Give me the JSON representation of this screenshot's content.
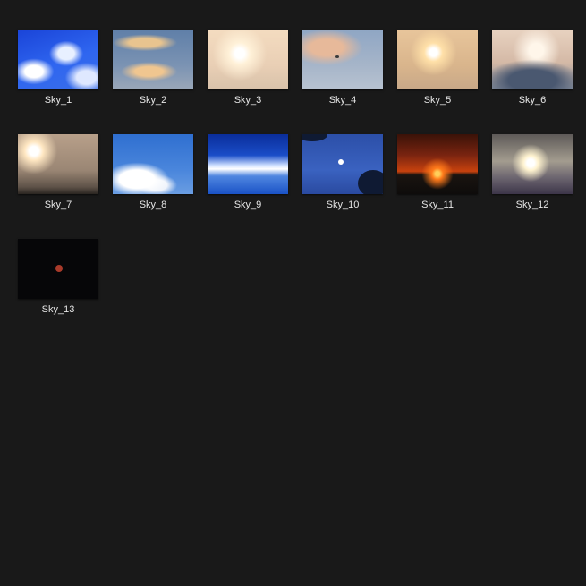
{
  "gallery": {
    "items": [
      {
        "label": "Sky_1"
      },
      {
        "label": "Sky_2"
      },
      {
        "label": "Sky_3"
      },
      {
        "label": "Sky_4"
      },
      {
        "label": "Sky_5"
      },
      {
        "label": "Sky_6"
      },
      {
        "label": "Sky_7"
      },
      {
        "label": "Sky_8"
      },
      {
        "label": "Sky_9"
      },
      {
        "label": "Sky_10"
      },
      {
        "label": "Sky_11"
      },
      {
        "label": "Sky_12"
      },
      {
        "label": "Sky_13"
      }
    ]
  },
  "colors": {
    "background": "#191919",
    "caption_text": "#e6e6e6"
  }
}
